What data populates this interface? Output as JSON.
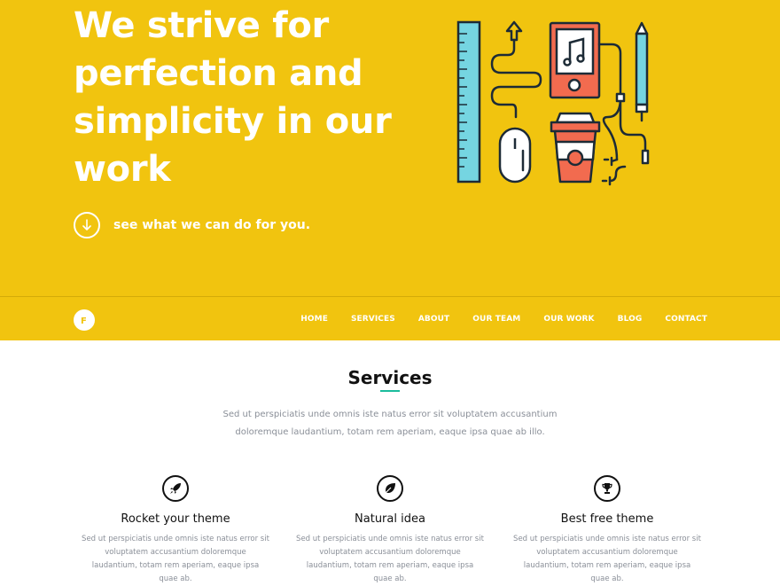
{
  "hero": {
    "title": "We strive for perfection and simplicity in our work",
    "cta_label": "see what we can do for you."
  },
  "navbar": {
    "logo_letter": "F",
    "items": [
      "HOME",
      "SERVICES",
      "ABOUT",
      "OUR TEAM",
      "OUR WORK",
      "BLOG",
      "CONTACT"
    ]
  },
  "services": {
    "title": "Services",
    "description": "Sed ut perspiciatis unde omnis iste natus error sit voluptatem accusantium doloremque laudantium, totam rem aperiam, eaque ipsa quae ab illo.",
    "features": [
      {
        "icon": "rocket-icon",
        "title": "Rocket your theme",
        "description": "Sed ut perspiciatis unde omnis iste natus error sit voluptatem accusantium doloremque laudantium, totam rem aperiam, eaque ipsa quae ab."
      },
      {
        "icon": "leaf-icon",
        "title": "Natural idea",
        "description": "Sed ut perspiciatis unde omnis iste natus error sit voluptatem accusantium doloremque laudantium, totam rem aperiam, eaque ipsa quae ab."
      },
      {
        "icon": "trophy-icon",
        "title": "Best free theme",
        "description": "Sed ut perspiciatis unde omnis iste natus error sit voluptatem accusantium doloremque laudantium, totam rem aperiam, eaque ipsa quae ab."
      }
    ]
  },
  "colors": {
    "brand_yellow": "#f1c40f",
    "accent_teal": "#1abc9c",
    "illus_blue": "#75d5e1",
    "illus_orange": "#f26b4f"
  }
}
